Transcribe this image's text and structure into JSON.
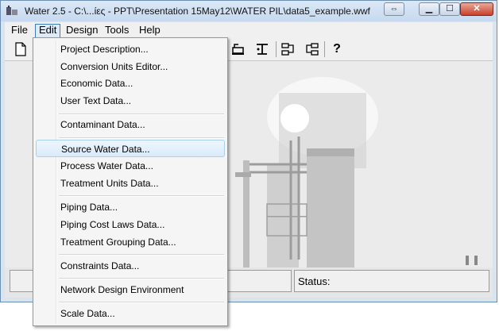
{
  "window": {
    "title": "Water 2.5 - C:\\...ίες - PPT\\Presentation 15May12\\WATER PIL\\data5_example.wwf",
    "controls": {
      "minimize": "▁",
      "maximize": "☐",
      "close": "✕",
      "restore_back": "⇔"
    }
  },
  "menubar": {
    "items": [
      {
        "label": "File"
      },
      {
        "label": "Edit"
      },
      {
        "label": "Design"
      },
      {
        "label": "Tools"
      },
      {
        "label": "Help"
      }
    ]
  },
  "toolbar": {
    "help_symbol": "?"
  },
  "statusbar": {
    "status_label": "Status:"
  },
  "edit_menu": {
    "items": [
      {
        "label": "Project Description..."
      },
      {
        "label": "Conversion Units Editor..."
      },
      {
        "label": "Economic Data..."
      },
      {
        "label": "User Text Data..."
      },
      {
        "label": "Contaminant Data..."
      },
      {
        "label": "Source Water Data..."
      },
      {
        "label": "Process Water Data..."
      },
      {
        "label": "Treatment Units Data..."
      },
      {
        "label": "Piping Data..."
      },
      {
        "label": "Piping Cost Laws Data..."
      },
      {
        "label": "Treatment Grouping Data..."
      },
      {
        "label": "Constraints Data..."
      },
      {
        "label": "Network Design Environment"
      },
      {
        "label": "Scale Data..."
      }
    ],
    "highlighted": "Source Water Data..."
  }
}
